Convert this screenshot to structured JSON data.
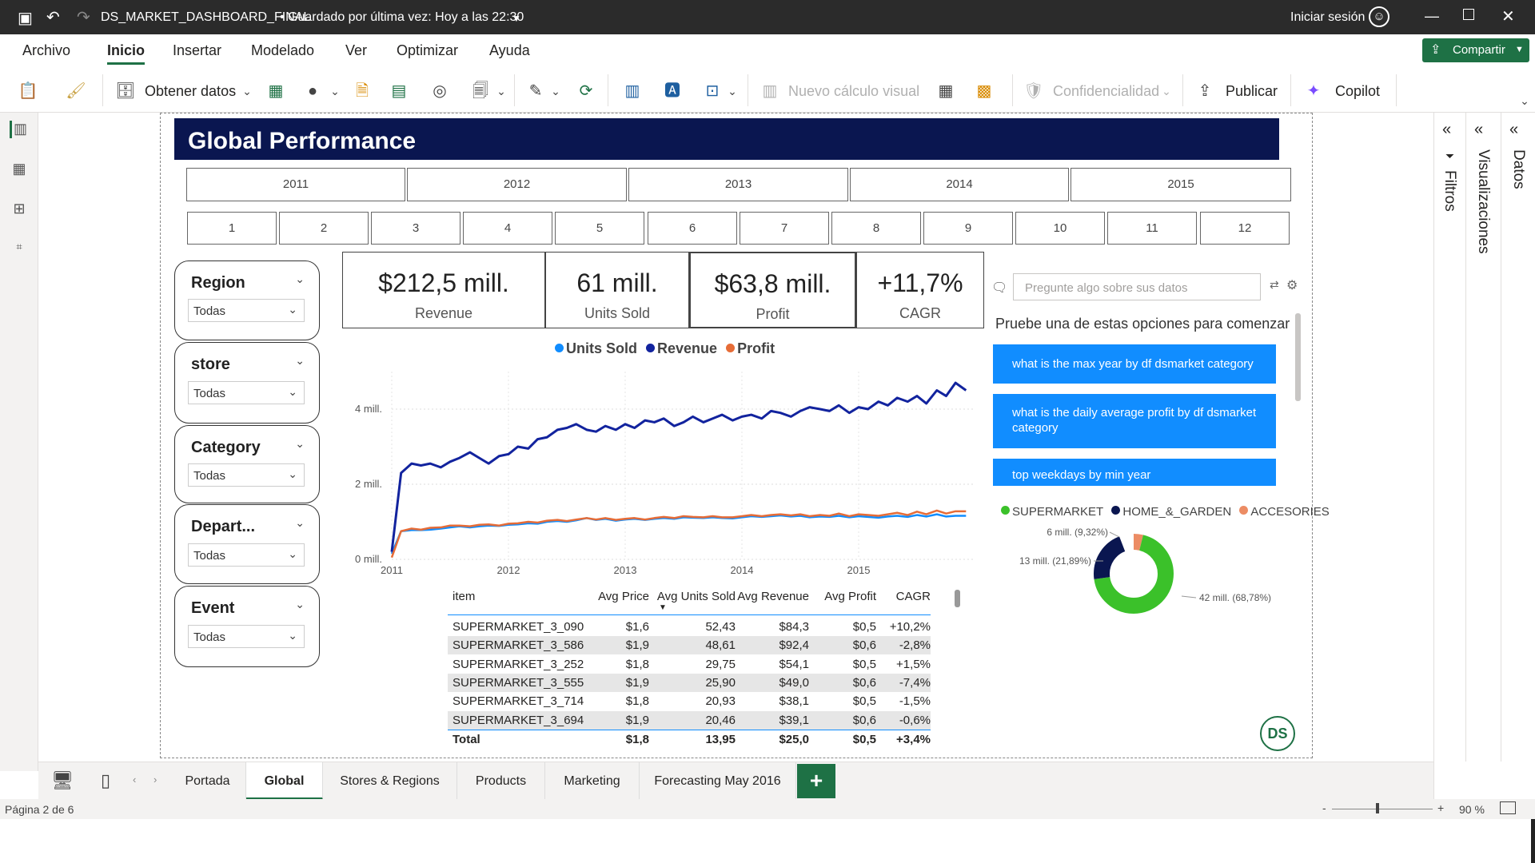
{
  "titlebar": {
    "file_title": "DS_MARKET_DASHBOARD_FINAL",
    "saved_status": "• Guardado por última vez: Hoy a las 22:30",
    "signin": "Iniciar sesión"
  },
  "menu": {
    "items": [
      "Archivo",
      "Inicio",
      "Insertar",
      "Modelado",
      "Ver",
      "Optimizar",
      "Ayuda"
    ],
    "active": "Inicio",
    "share_label": "Compartir"
  },
  "toolbar": {
    "get_data": "Obtener datos",
    "new_visual_calc": "Nuevo cálculo visual",
    "sensitivity": "Confidencialidad",
    "publish": "Publicar",
    "copilot": "Copilot"
  },
  "report": {
    "title": "Global Performance",
    "years": [
      "2011",
      "2012",
      "2013",
      "2014",
      "2015"
    ],
    "months": [
      "1",
      "2",
      "3",
      "4",
      "5",
      "6",
      "7",
      "8",
      "9",
      "10",
      "11",
      "12"
    ],
    "slicers": [
      {
        "title": "Region",
        "value": "Todas"
      },
      {
        "title": "store",
        "value": "Todas"
      },
      {
        "title": "Category",
        "value": "Todas"
      },
      {
        "title": "Depart...",
        "value": "Todas"
      },
      {
        "title": "Event",
        "value": "Todas"
      }
    ],
    "kpis": [
      {
        "value": "$212,5 mill.",
        "label": "Revenue"
      },
      {
        "value": "61 mill.",
        "label": "Units Sold"
      },
      {
        "value": "$63,8 mill.",
        "label": "Profit"
      },
      {
        "value": "+11,7%",
        "label": "CAGR"
      }
    ],
    "qa": {
      "placeholder": "Pregunte algo sobre sus datos",
      "prompt": "Pruebe una de estas opciones para comenzar",
      "suggestions": [
        "what is the max year by df dsmarket category",
        "what is the daily average profit by df dsmarket category",
        "top weekdays by min year"
      ]
    },
    "table": {
      "headers": [
        "item",
        "Avg Price",
        "Avg Units Sold",
        "Avg Revenue",
        "Avg Profit",
        "CAGR"
      ],
      "rows": [
        [
          "SUPERMARKET_3_090",
          "$1,6",
          "52,43",
          "$84,3",
          "$0,5",
          "+10,2%"
        ],
        [
          "SUPERMARKET_3_586",
          "$1,9",
          "48,61",
          "$92,4",
          "$0,6",
          "-2,8%"
        ],
        [
          "SUPERMARKET_3_252",
          "$1,8",
          "29,75",
          "$54,1",
          "$0,5",
          "+1,5%"
        ],
        [
          "SUPERMARKET_3_555",
          "$1,9",
          "25,90",
          "$49,0",
          "$0,6",
          "-7,4%"
        ],
        [
          "SUPERMARKET_3_714",
          "$1,8",
          "20,93",
          "$38,1",
          "$0,5",
          "-1,5%"
        ],
        [
          "SUPERMARKET_3_694",
          "$1,9",
          "20,46",
          "$39,1",
          "$0,6",
          "-0,6%"
        ]
      ],
      "total": [
        "Total",
        "$1,8",
        "13,95",
        "$25,0",
        "$0,5",
        "+3,4%"
      ]
    },
    "logo_text": "DS"
  },
  "colors": {
    "title_bg": "#0a1650",
    "units_sold": "#118dff",
    "revenue": "#12239e",
    "profit": "#e66c37",
    "supermarket": "#3bc12a",
    "home_garden": "#0a1650",
    "accesories": "#ec8c64",
    "accent_green": "#1e7145"
  },
  "chart_data": [
    {
      "type": "line",
      "series": [
        {
          "name": "Units Sold",
          "color": "#118dff",
          "x": [
            2011.0,
            2011.08,
            2011.17,
            2011.25,
            2011.33,
            2011.42,
            2011.5,
            2011.58,
            2011.67,
            2011.75,
            2011.83,
            2011.92,
            2012.0,
            2012.08,
            2012.17,
            2012.25,
            2012.33,
            2012.42,
            2012.5,
            2012.58,
            2012.67,
            2012.75,
            2012.83,
            2012.92,
            2013.0,
            2013.08,
            2013.17,
            2013.25,
            2013.33,
            2013.42,
            2013.5,
            2013.58,
            2013.67,
            2013.75,
            2013.83,
            2013.92,
            2014.0,
            2014.08,
            2014.17,
            2014.25,
            2014.33,
            2014.42,
            2014.5,
            2014.58,
            2014.67,
            2014.75,
            2014.83,
            2014.92,
            2015.0,
            2015.08,
            2015.17,
            2015.25,
            2015.33,
            2015.42,
            2015.5,
            2015.58,
            2015.67,
            2015.75,
            2015.83,
            2015.92
          ],
          "y": [
            0.15,
            0.75,
            0.78,
            0.78,
            0.79,
            0.82,
            0.85,
            0.88,
            0.85,
            0.88,
            0.9,
            0.89,
            0.92,
            0.93,
            0.96,
            0.95,
            1.0,
            1.02,
            1.0,
            1.04,
            1.1,
            1.05,
            1.08,
            1.03,
            1.06,
            1.08,
            1.05,
            1.08,
            1.1,
            1.08,
            1.12,
            1.11,
            1.1,
            1.12,
            1.1,
            1.09,
            1.12,
            1.15,
            1.13,
            1.15,
            1.17,
            1.14,
            1.16,
            1.12,
            1.14,
            1.13,
            1.16,
            1.12,
            1.15,
            1.13,
            1.11,
            1.14,
            1.16,
            1.13,
            1.18,
            1.14,
            1.2,
            1.14,
            1.16,
            1.16
          ]
        },
        {
          "name": "Revenue",
          "color": "#12239e",
          "x": [
            2011.0,
            2011.08,
            2011.17,
            2011.25,
            2011.33,
            2011.42,
            2011.5,
            2011.58,
            2011.67,
            2011.75,
            2011.83,
            2011.92,
            2012.0,
            2012.08,
            2012.17,
            2012.25,
            2012.33,
            2012.42,
            2012.5,
            2012.58,
            2012.67,
            2012.75,
            2012.83,
            2012.92,
            2013.0,
            2013.08,
            2013.17,
            2013.25,
            2013.33,
            2013.42,
            2013.5,
            2013.58,
            2013.67,
            2013.75,
            2013.83,
            2013.92,
            2014.0,
            2014.08,
            2014.17,
            2014.25,
            2014.33,
            2014.42,
            2014.5,
            2014.58,
            2014.67,
            2014.75,
            2014.83,
            2014.92,
            2015.0,
            2015.08,
            2015.17,
            2015.25,
            2015.33,
            2015.42,
            2015.5,
            2015.58,
            2015.67,
            2015.75,
            2015.83,
            2015.92
          ],
          "y": [
            0.2,
            2.3,
            2.55,
            2.5,
            2.55,
            2.45,
            2.6,
            2.7,
            2.85,
            2.7,
            2.55,
            2.75,
            2.8,
            3.0,
            2.95,
            3.2,
            3.25,
            3.45,
            3.5,
            3.6,
            3.45,
            3.4,
            3.55,
            3.45,
            3.6,
            3.5,
            3.7,
            3.65,
            3.75,
            3.55,
            3.65,
            3.8,
            3.65,
            3.75,
            3.85,
            3.7,
            3.8,
            3.85,
            3.75,
            3.95,
            3.9,
            3.8,
            3.95,
            4.05,
            4.0,
            3.95,
            4.1,
            3.9,
            4.05,
            4.0,
            4.2,
            4.1,
            4.3,
            4.2,
            4.35,
            4.15,
            4.5,
            4.35,
            4.7,
            4.5
          ]
        },
        {
          "name": "Profit",
          "color": "#e66c37",
          "x": [
            2011.0,
            2011.08,
            2011.17,
            2011.25,
            2011.33,
            2011.42,
            2011.5,
            2011.58,
            2011.67,
            2011.75,
            2011.83,
            2011.92,
            2012.0,
            2012.08,
            2012.17,
            2012.25,
            2012.33,
            2012.42,
            2012.5,
            2012.58,
            2012.67,
            2012.75,
            2012.83,
            2012.92,
            2013.0,
            2013.08,
            2013.17,
            2013.25,
            2013.33,
            2013.42,
            2013.5,
            2013.58,
            2013.67,
            2013.75,
            2013.83,
            2013.92,
            2014.0,
            2014.08,
            2014.17,
            2014.25,
            2014.33,
            2014.42,
            2014.5,
            2014.58,
            2014.67,
            2014.75,
            2014.83,
            2014.92,
            2015.0,
            2015.08,
            2015.17,
            2015.25,
            2015.33,
            2015.42,
            2015.5,
            2015.58,
            2015.67,
            2015.75,
            2015.83,
            2015.92
          ],
          "y": [
            0.05,
            0.75,
            0.82,
            0.79,
            0.84,
            0.85,
            0.9,
            0.9,
            0.88,
            0.92,
            0.93,
            0.9,
            0.95,
            0.96,
            1.0,
            0.98,
            1.03,
            1.05,
            1.02,
            1.06,
            1.1,
            1.06,
            1.1,
            1.05,
            1.08,
            1.1,
            1.06,
            1.1,
            1.13,
            1.1,
            1.15,
            1.13,
            1.12,
            1.15,
            1.12,
            1.12,
            1.15,
            1.18,
            1.15,
            1.18,
            1.2,
            1.17,
            1.2,
            1.15,
            1.18,
            1.16,
            1.22,
            1.15,
            1.2,
            1.18,
            1.16,
            1.2,
            1.24,
            1.18,
            1.27,
            1.2,
            1.3,
            1.22,
            1.28,
            1.28
          ]
        }
      ],
      "x_ticks": [
        "2011",
        "2012",
        "2013",
        "2014",
        "2015"
      ],
      "y_ticks": [
        "0 mill.",
        "2 mill.",
        "4 mill."
      ],
      "ylim": [
        0,
        5
      ],
      "grid": true,
      "legend": "top"
    },
    {
      "type": "pie",
      "donut": true,
      "categories": [
        "SUPERMARKET",
        "HOME_&_GARDEN",
        "ACCESORIES"
      ],
      "values": [
        42,
        13,
        6
      ],
      "data_labels": [
        "42 mill. (68,78%)",
        "13 mill. (21,89%)",
        "6 mill. (9,32%)"
      ],
      "legend": "top"
    }
  ],
  "pages": {
    "tabs": [
      "Portada",
      "Global",
      "Stores & Regions",
      "Products",
      "Marketing",
      "Forecasting May 2016"
    ],
    "active": "Global"
  },
  "statusbar": {
    "page_info": "Página 2 de 6",
    "zoom": "90 %"
  },
  "panes": {
    "filters": "Filtros",
    "visualizations": "Visualizaciones",
    "data": "Datos"
  }
}
